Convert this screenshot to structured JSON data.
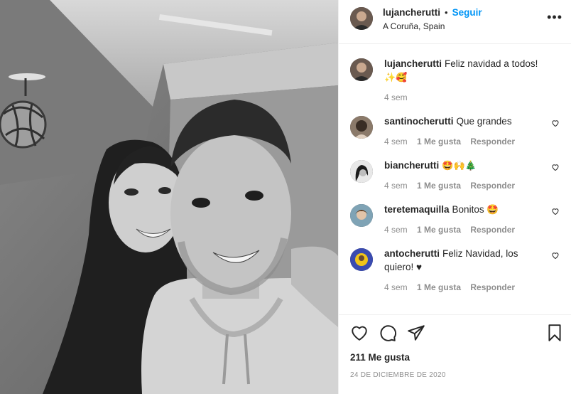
{
  "post": {
    "username": "lujancherutti",
    "separator": "•",
    "follow_label": "Seguir",
    "location": "A Coruña, Spain",
    "more_label": "•••"
  },
  "caption": {
    "username": "lujancherutti",
    "text": "Feliz navidad a todos!",
    "emoji": "✨🥰",
    "time": "4 sem"
  },
  "comments": [
    {
      "username": "santinocherutti",
      "text": "Que grandes",
      "time": "4 sem",
      "likes": "1 Me gusta",
      "reply": "Responder"
    },
    {
      "username": "biancherutti",
      "text": "🤩🙌🎄",
      "time": "4 sem",
      "likes": "1 Me gusta",
      "reply": "Responder"
    },
    {
      "username": "teretemaquilla",
      "text": "Bonitos 🤩",
      "time": "4 sem",
      "likes": "1 Me gusta",
      "reply": "Responder"
    },
    {
      "username": "antocherutti",
      "text": "Feliz Navidad, los quiero! ♥",
      "time": "4 sem",
      "likes": "1 Me gusta",
      "reply": "Responder"
    }
  ],
  "footer": {
    "likes": "211 Me gusta",
    "date": "24 DE DICIEMBRE DE 2020"
  },
  "icons": {
    "heart": "heart-icon",
    "comment": "comment-icon",
    "share": "share-icon",
    "save": "bookmark-icon"
  },
  "colors": {
    "accent": "#0095f6",
    "muted": "#8e8e8e",
    "text": "#262626"
  }
}
